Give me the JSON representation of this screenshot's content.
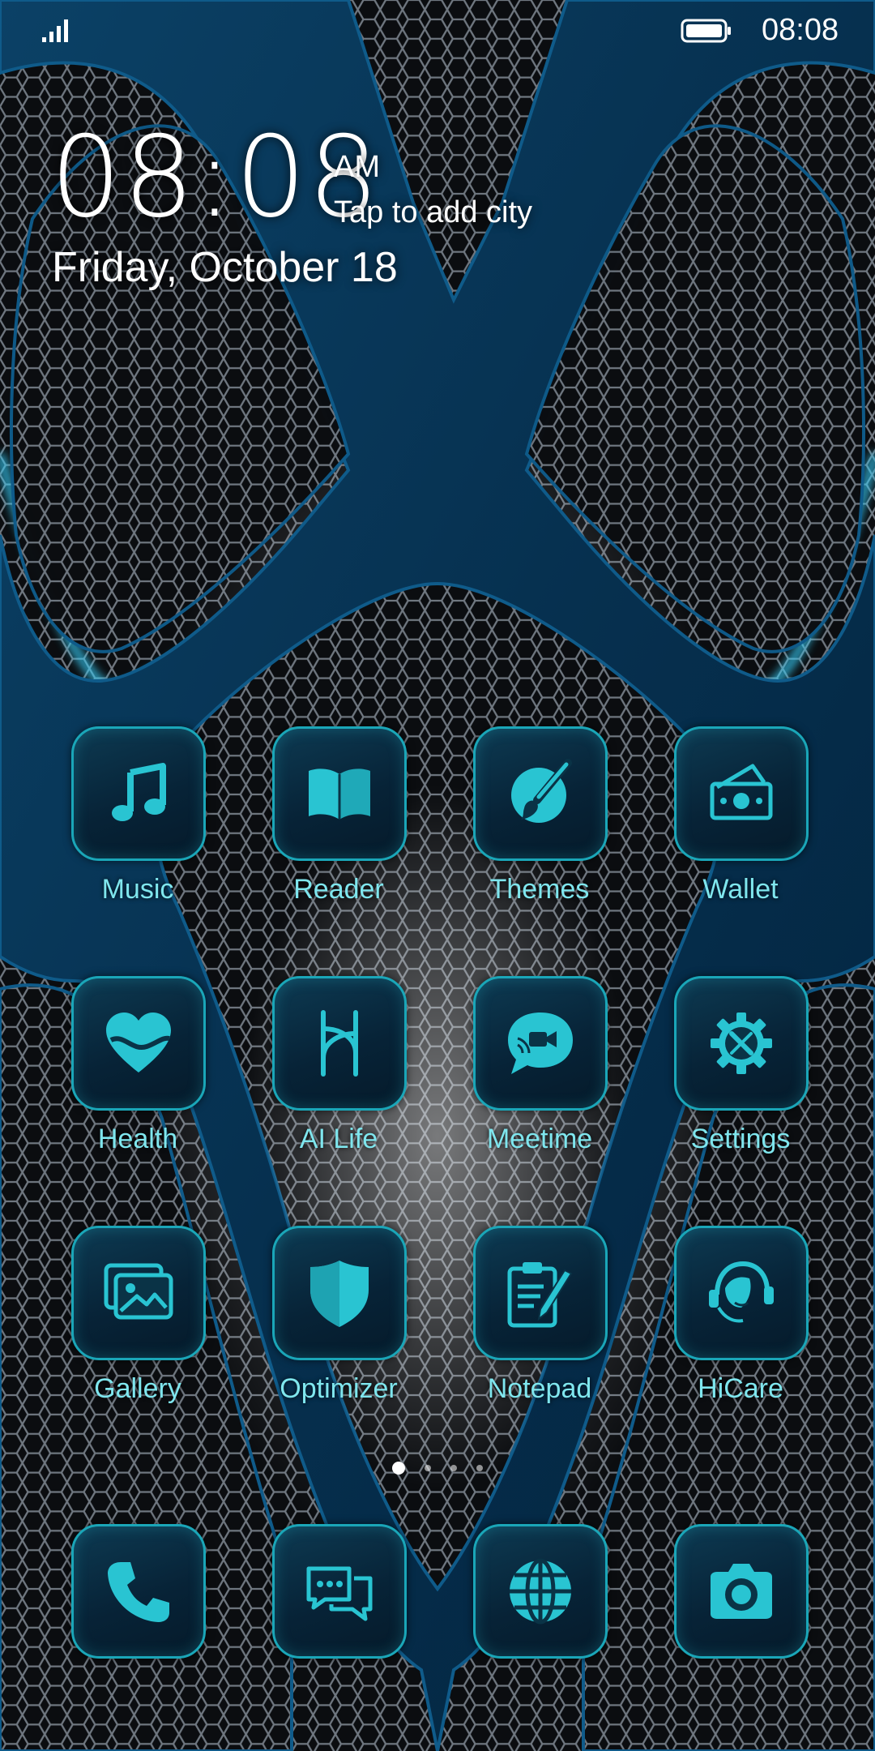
{
  "status_bar": {
    "time": "08:08",
    "signal_icon": "signal-bars-icon",
    "battery_icon": "battery-full-icon"
  },
  "clock": {
    "time": "08:08",
    "ampm": "AM",
    "city_prompt": "Tap to add city",
    "date": "Friday, October 18"
  },
  "apps": [
    {
      "label": "Music",
      "icon": "music-note-icon"
    },
    {
      "label": "Reader",
      "icon": "open-book-icon"
    },
    {
      "label": "Themes",
      "icon": "paintbrush-icon"
    },
    {
      "label": "Wallet",
      "icon": "wallet-cash-icon"
    },
    {
      "label": "Health",
      "icon": "heart-icon"
    },
    {
      "label": "AI Life",
      "icon": "ai-life-icon"
    },
    {
      "label": "Meetime",
      "icon": "video-chat-icon"
    },
    {
      "label": "Settings",
      "icon": "gear-tools-icon"
    },
    {
      "label": "Gallery",
      "icon": "photo-icon"
    },
    {
      "label": "Optimizer",
      "icon": "shield-icon"
    },
    {
      "label": "Notepad",
      "icon": "clipboard-pencil-icon"
    },
    {
      "label": "HiCare",
      "icon": "headset-icon"
    }
  ],
  "dock": [
    {
      "icon": "phone-icon"
    },
    {
      "icon": "messages-icon"
    },
    {
      "icon": "globe-icon"
    },
    {
      "icon": "camera-icon"
    }
  ],
  "pages": {
    "count": 4,
    "current": 1
  },
  "colors": {
    "accent": "#29c4d2",
    "label": "#7fe6ee",
    "tile_border": "#1aa6b8",
    "wallpaper_blue": "#0a3a5c",
    "glow": "#39d4ff"
  }
}
